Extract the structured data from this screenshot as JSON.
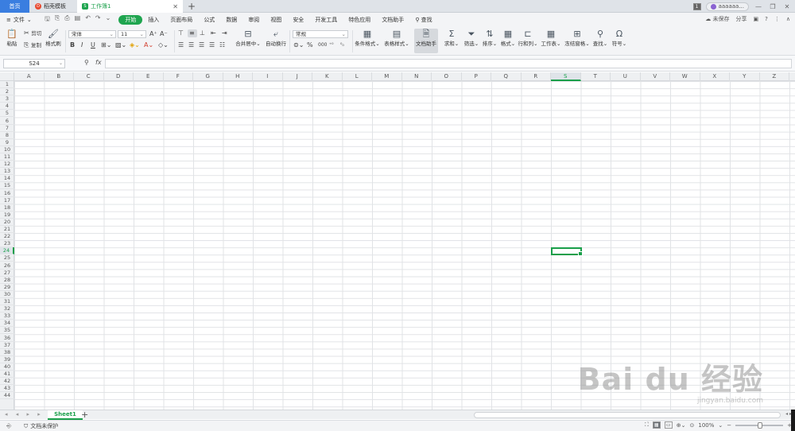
{
  "tabs": {
    "home": "首页",
    "templates": "稻壳模板",
    "workbook": "工作簿1",
    "new_tab": "+",
    "close": "✕"
  },
  "titlebar": {
    "badge": "1",
    "user": "aaaaaa...",
    "minimize": "—",
    "restore": "❐",
    "close": "✕"
  },
  "menu": {
    "file": "文件",
    "items": [
      "开始",
      "插入",
      "页面布局",
      "公式",
      "数据",
      "审阅",
      "视图",
      "安全",
      "开发工具",
      "特色应用",
      "文档助手"
    ],
    "search": "查找",
    "unsaved": "未保存",
    "share": "分享",
    "help": "?",
    "more": "⋮",
    "collapse": "∧"
  },
  "ribbon": {
    "paste": "粘贴",
    "cut": "剪切",
    "copy": "复制",
    "format_painter": "格式刷",
    "font_name": "宋体",
    "font_size": "11",
    "bold": "B",
    "italic": "I",
    "underline": "U",
    "font_color": "A",
    "merge_center": "合并居中",
    "auto_wrap": "自动换行",
    "number_format": "常规",
    "percent": "%",
    "thousands": "000",
    "conditional_format": "条件格式",
    "table_style": "表格样式",
    "doc_assistant": "文档助手",
    "sum": "求和",
    "filter": "筛选",
    "sort": "排序",
    "format": "格式",
    "rows_cols": "行和列",
    "worksheet": "工作表",
    "freeze_panes": "冻结窗格",
    "find": "查找",
    "symbol": "符号"
  },
  "formula": {
    "cell_ref": "S24",
    "fx": "fx",
    "value": ""
  },
  "grid": {
    "columns": [
      "A",
      "B",
      "C",
      "D",
      "E",
      "F",
      "G",
      "H",
      "I",
      "J",
      "K",
      "L",
      "M",
      "N",
      "O",
      "P",
      "Q",
      "R",
      "S",
      "T",
      "U",
      "V",
      "W",
      "X",
      "Y",
      "Z"
    ],
    "rows": 44,
    "selected_col": "S",
    "selected_row": 24
  },
  "sheets": {
    "tabs": [
      "Sheet1"
    ],
    "add": "+"
  },
  "status": {
    "protect": "文档未保护",
    "zoom": "100%",
    "zoom_level": 1.0,
    "zoom_in": "+",
    "zoom_out": "−"
  },
  "watermark": {
    "brand": "Bai du 经验",
    "url": "jingyan.baidu.com"
  },
  "colors": {
    "accent_green": "#1fa54f",
    "home_tab_blue": "#3a7ee0",
    "selection_green": "#1a9f4a"
  }
}
